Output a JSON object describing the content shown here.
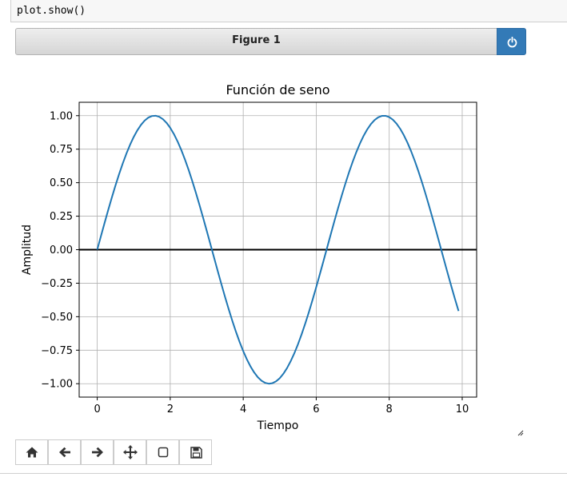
{
  "code_cell": {
    "code": "plot.show()"
  },
  "figure": {
    "label": "Figure 1",
    "power_icon": "power-icon"
  },
  "chart_data": {
    "type": "line",
    "title": "Función de seno",
    "xlabel": "Tiempo",
    "ylabel": "Amplitud",
    "xlim": [
      -0.495,
      10.395
    ],
    "ylim": [
      -1.1,
      1.1
    ],
    "xticks": [
      0,
      2,
      4,
      6,
      8,
      10
    ],
    "xtick_labels": [
      "0",
      "2",
      "4",
      "6",
      "8",
      "10"
    ],
    "yticks": [
      1.0,
      0.75,
      0.5,
      0.25,
      0.0,
      -0.25,
      -0.5,
      -0.75,
      -1.0
    ],
    "ytick_labels": [
      "1.00",
      "0.75",
      "0.50",
      "0.25",
      "0.00",
      "−0.25",
      "−0.50",
      "−0.75",
      "−1.00"
    ],
    "grid": true,
    "series": [
      {
        "function": "sin(x)",
        "x_start": 0,
        "x_end": 9.9,
        "x_step": 0.1,
        "color": "#1f77b4"
      }
    ],
    "reference_lines": [
      {
        "y": 0,
        "color": "#000000"
      }
    ]
  },
  "toolbar": {
    "buttons": [
      {
        "name": "home-button",
        "icon": "home-icon"
      },
      {
        "name": "back-button",
        "icon": "arrow-left-icon"
      },
      {
        "name": "forward-button",
        "icon": "arrow-right-icon"
      },
      {
        "name": "pan-button",
        "icon": "move-icon"
      },
      {
        "name": "zoom-button",
        "icon": "square-icon"
      },
      {
        "name": "save-button",
        "icon": "floppy-disk-icon"
      }
    ]
  }
}
